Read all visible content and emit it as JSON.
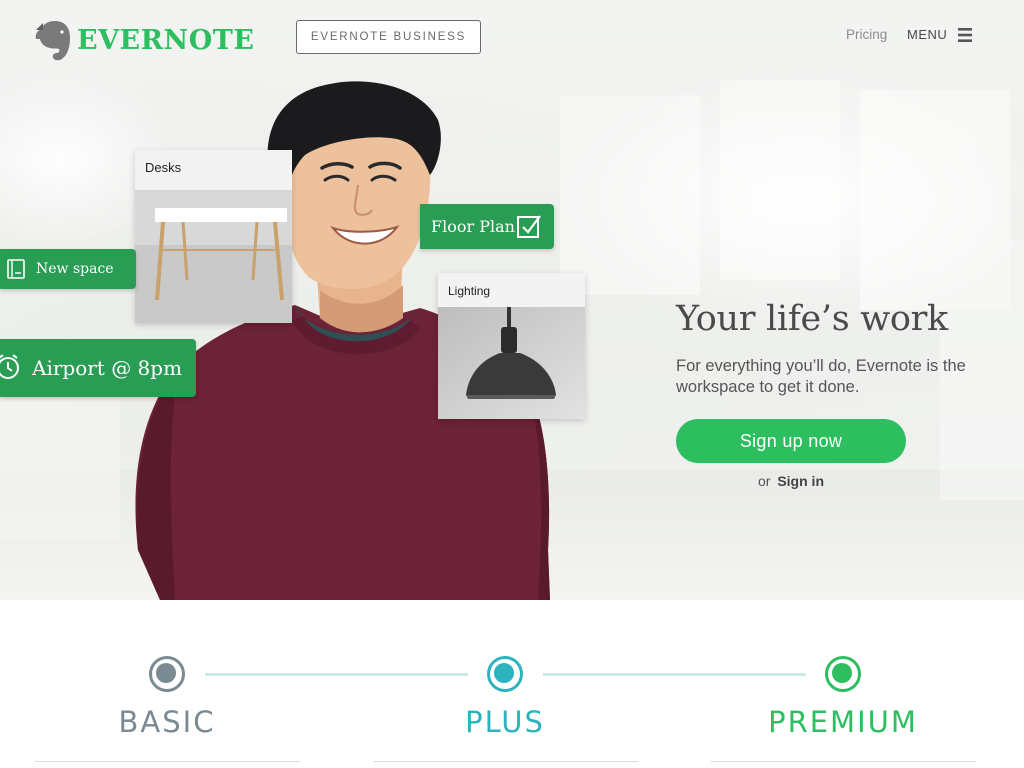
{
  "header": {
    "logo_text": "EVERNOTE",
    "business_button": "EVERNOTE BUSINESS",
    "pricing_link": "Pricing",
    "menu_label": "MENU",
    "brand_color": "#2dbe60"
  },
  "hero": {
    "title": "Your life’s work",
    "subtitle": "For everything you’ll do, Evernote is the workspace to get it done.",
    "signup_label": "Sign up now",
    "signin_prefix": "or",
    "signin_label": "Sign in",
    "cards": {
      "desks": "Desks",
      "lighting": "Lighting"
    },
    "tags": {
      "floor_plan": "Floor Plan",
      "new_space": "New space",
      "airport": "Airport @ 8pm"
    }
  },
  "plans": {
    "items": [
      {
        "name": "BASIC",
        "color": "#7a8a93"
      },
      {
        "name": "PLUS",
        "color": "#2cb3bf"
      },
      {
        "name": "PREMIUM",
        "color": "#2dbe60"
      }
    ]
  }
}
